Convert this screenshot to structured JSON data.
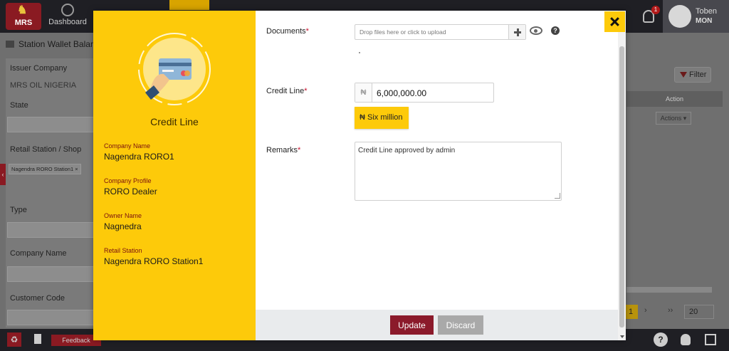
{
  "app": {
    "logo_text": "MRS",
    "nav_dashboard": "Dashboard",
    "notification_count": "1",
    "user_first": "Toben",
    "user_last": "MON",
    "page_title": "Station Wallet Balan"
  },
  "filters": {
    "issuer_company_label": "Issuer Company",
    "issuer_company_value": "MRS OIL NIGERIA",
    "state_label": "State",
    "retail_station_label": "Retail Station / Shop",
    "retail_station_chip": "Nagendra RORO Station1 ×",
    "type_label": "Type",
    "company_name_label": "Company Name",
    "customer_code_label": "Customer Code"
  },
  "table": {
    "filter_button": "Filter",
    "action_header": "Action",
    "actions_dropdown": "Actions ▾",
    "pager_current": "1",
    "pager_next": "›",
    "pager_last": "››",
    "page_size": "20"
  },
  "bottom": {
    "feedback": "Feedback"
  },
  "modal": {
    "heading": "Credit Line",
    "info": [
      {
        "label": "Company Name",
        "value": "Nagendra RORO1"
      },
      {
        "label": "Company Profile",
        "value": "RORO Dealer"
      },
      {
        "label": "Owner Name",
        "value": "Nagnedra"
      },
      {
        "label": "Retail Station",
        "value": "Nagendra RORO Station1"
      }
    ],
    "documents_label": "Documents",
    "documents_placeholder": "Drop files here or click to upload",
    "credit_line_label": "Credit Line",
    "currency_symbol": "₦",
    "credit_line_value": "6,000,000.00",
    "amount_in_words": "₦ Six million",
    "remarks_label": "Remarks",
    "remarks_value": "Credit Line approved by admin",
    "update_button": "Update",
    "discard_button": "Discard",
    "required_mark": "*"
  },
  "colors": {
    "brand_yellow": "#fdca0a",
    "update_red": "#8b1a2b",
    "discard_gray": "#a9a9a9",
    "topbar": "#1f1f24"
  }
}
